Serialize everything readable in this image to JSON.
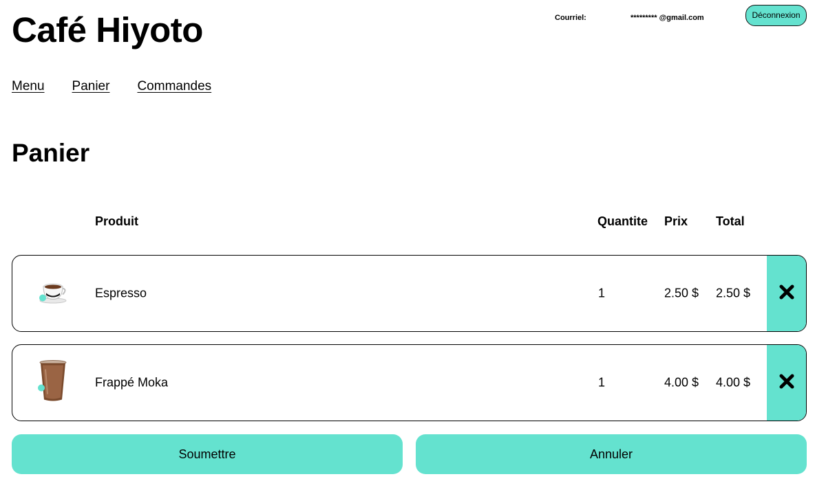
{
  "header": {
    "site_title": "Café Hiyoto",
    "email_label": "Courriel:",
    "email_value": "********* @gmail.com",
    "logout_label": "Déconnexion"
  },
  "nav": {
    "items": [
      {
        "label": "Menu"
      },
      {
        "label": "Panier"
      },
      {
        "label": "Commandes"
      }
    ]
  },
  "cart": {
    "title": "Panier",
    "columns": {
      "product": "Produit",
      "quantity": "Quantite",
      "price": "Prix",
      "total": "Total"
    },
    "items": [
      {
        "name": "Espresso",
        "quantity": "1",
        "price": "2.50 $",
        "total": "2.50 $",
        "icon": "espresso-cup-icon"
      },
      {
        "name": "Frappé Moka",
        "quantity": "1",
        "price": "4.00 $",
        "total": "4.00 $",
        "icon": "iced-mocha-cup-icon"
      }
    ],
    "remove_icon": "close-icon"
  },
  "actions": {
    "submit_label": "Soumettre",
    "cancel_label": "Annuler"
  },
  "colors": {
    "accent": "#64e2cf",
    "text": "#000000",
    "background": "#ffffff"
  }
}
